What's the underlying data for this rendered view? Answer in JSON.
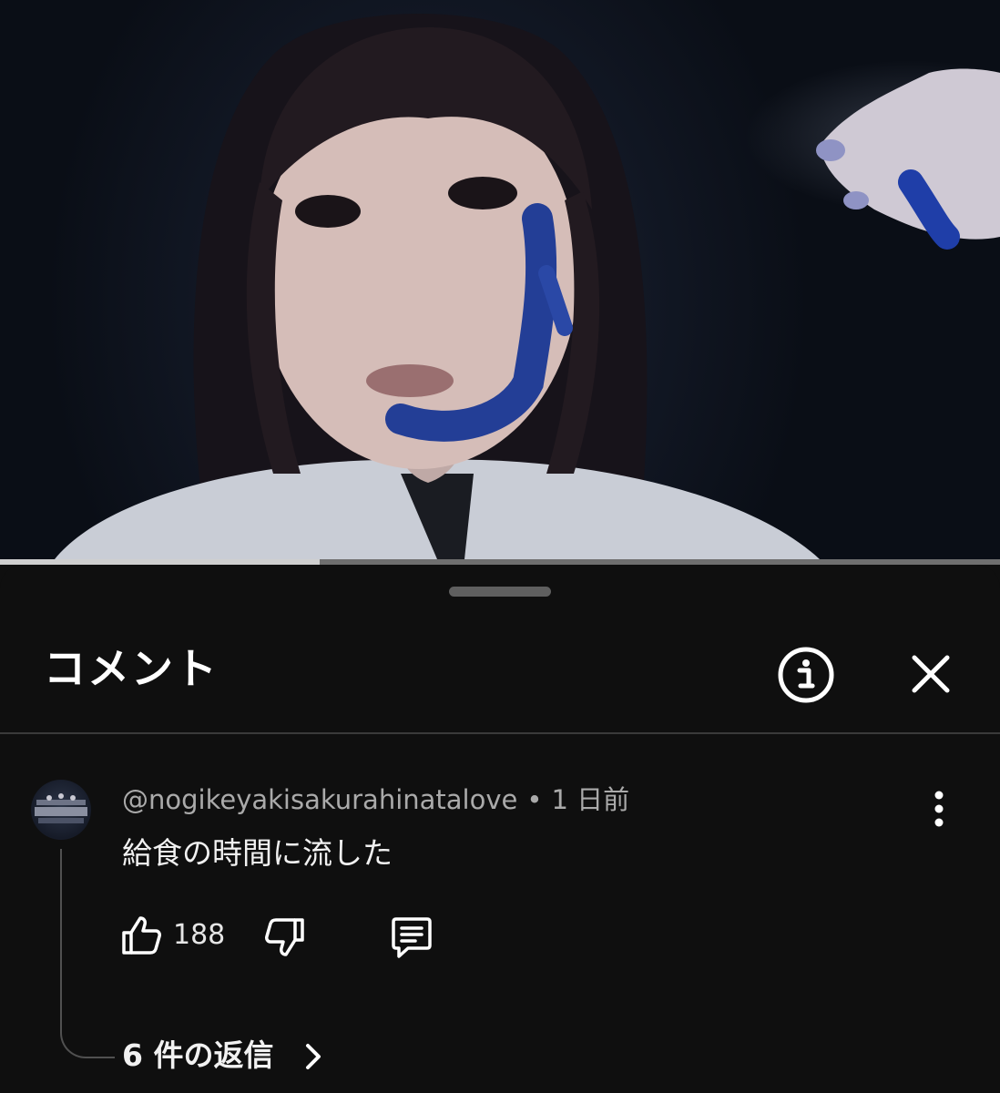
{
  "video": {
    "progress": 0.32
  },
  "comments_sheet": {
    "title": "コメント",
    "info_icon": "info-circle-icon",
    "close_icon": "close-icon"
  },
  "comment": {
    "author": "@nogikeyakisakurahinatalove",
    "separator": "•",
    "time": "1 日前",
    "text": "給食の時間に流した",
    "like_count": "188",
    "like_icon": "thumbs-up-icon",
    "dislike_icon": "thumbs-down-icon",
    "reply_icon": "comment-reply-icon",
    "more_icon": "more-vertical-icon",
    "replies_label": "6 件の返信",
    "replies_icon": "chevron-right-icon"
  }
}
